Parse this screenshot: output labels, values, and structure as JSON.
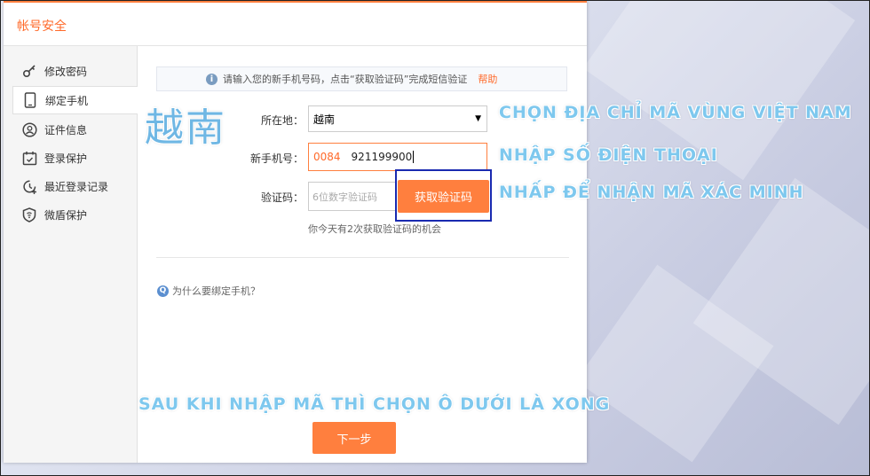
{
  "window": {
    "title": "帐号安全"
  },
  "sidebar": {
    "items": [
      {
        "label": "修改密码",
        "icon": "key-icon"
      },
      {
        "label": "绑定手机",
        "icon": "phone-icon"
      },
      {
        "label": "证件信息",
        "icon": "id-card-icon"
      },
      {
        "label": "登录保护",
        "icon": "login-protect-icon"
      },
      {
        "label": "最近登录记录",
        "icon": "history-icon"
      },
      {
        "label": "微盾保护",
        "icon": "shield-icon"
      }
    ],
    "active_index": 1
  },
  "notice": {
    "text": "请输入您的新手机号码，点击“获取验证码”完成短信验证",
    "help_label": "帮助"
  },
  "form": {
    "location_label": "所在地：",
    "location_value": "越南",
    "phone_label": "新手机号：",
    "phone_prefix": "0084",
    "phone_number": "921199900",
    "code_label": "验证码：",
    "code_placeholder": "6位数字验证码",
    "get_code_label": "获取验证码",
    "remaining_text": "你今天有2次获取验证码的机会"
  },
  "faq": {
    "icon_letter": "Q",
    "label": "为什么要绑定手机？"
  },
  "next_button_label": "下一步",
  "annotations": {
    "country_handwritten": "越南",
    "step_select_region": "CHỌN ĐỊA CHỈ MÃ VÙNG VIỆT NAM",
    "step_enter_phone": "NHẬP SỐ ĐIỆN THOẠI",
    "step_get_code": "NHẤP ĐỂ NHẬN MÃ XÁC MINH",
    "step_finish": "SAU KHI NHẬP MÃ THÌ CHỌN Ô DƯỚI LÀ XONG"
  },
  "colors": {
    "accent": "#ff7f3e",
    "annotation": "#7ec8ee",
    "highlight_box": "#1a2ab0"
  }
}
